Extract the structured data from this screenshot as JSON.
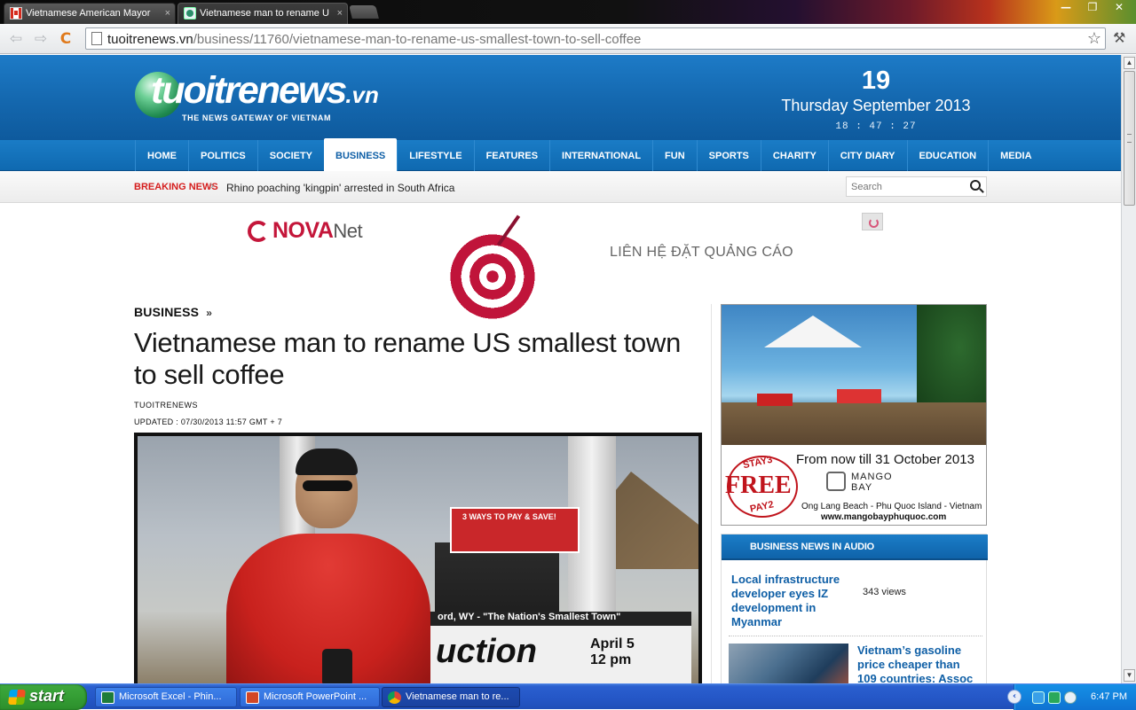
{
  "browser": {
    "tabs": [
      {
        "title": "Vietnamese American Mayor",
        "close": "×"
      },
      {
        "title": "Vietnamese man to rename U",
        "close": "×"
      }
    ],
    "window_buttons": [
      "—",
      "❐",
      "✕"
    ],
    "url_host": "tuoitrenews.vn",
    "url_path": "/business/11760/vietnamese-man-to-rename-us-smallest-town-to-sell-coffee",
    "back_icon": "⇦",
    "forward_icon": "⇨",
    "reload_icon": "C",
    "star_icon": "☆",
    "wrench_icon": "⚒"
  },
  "site": {
    "logo": "tuoitrenews",
    "logo_tld": ".vn",
    "tagline": "THE NEWS GATEWAY OF VIETNAM",
    "day": "19",
    "date": "Thursday September 2013",
    "time": "18 : 47 : 27"
  },
  "nav": {
    "items": [
      "HOME",
      "POLITICS",
      "SOCIETY",
      "BUSINESS",
      "LIFESTYLE",
      "FEATURES",
      "INTERNATIONAL",
      "FUN",
      "SPORTS",
      "CHARITY",
      "CITY DIARY",
      "EDUCATION",
      "MEDIA"
    ],
    "active": "BUSINESS"
  },
  "breaking": {
    "label": "BREAKING NEWS",
    "arrow": "›",
    "headline": "Rhino poaching 'kingpin' arrested in South Africa",
    "search_placeholder": "Search"
  },
  "ad_banner": {
    "brand": "NOVA",
    "brand_suffix": "Net",
    "text": "LIÊN HỆ ĐẶT QUẢNG CÁO"
  },
  "article": {
    "section": "BUSINESS",
    "section_chev": "»",
    "title": "Vietnamese man to rename US smallest town to sell coffee",
    "byline": "TUOITRENEWS",
    "updated": "UPDATED : 07/30/2013 11:57 GMT + 7",
    "photo": {
      "sign": "3 WAYS TO PAY & SAVE!",
      "board_top": "ord, WY - \"The Nation's Smallest Town\"",
      "board_big": "uction",
      "board_date_1": "April 5",
      "board_date_2": "12 pm"
    }
  },
  "right_ad": {
    "free_top": "STAY3",
    "free_big": "FREE",
    "free_bot": "PAY2",
    "offer": "From now till 31 October 2013",
    "brand_1": "MANGO",
    "brand_2": "BAY",
    "address": "Ong Lang Beach - Phu Quoc Island - Vietnam",
    "website": "www.mangobayphuquoc.com"
  },
  "audio": {
    "heading": "BUSINESS NEWS IN AUDIO",
    "items": [
      {
        "title": "Local infrastructure developer eyes IZ development in Myanmar",
        "views": "343 views"
      },
      {
        "title": "Vietnam’s gasoline price cheaper than 109 countries: Assoc"
      }
    ]
  },
  "taskbar": {
    "start": "start",
    "tasks": [
      {
        "label": "Microsoft Excel - Phin..."
      },
      {
        "label": "Microsoft PowerPoint ..."
      },
      {
        "label": "Vietnamese man to re..."
      }
    ],
    "tray_chev": "‹",
    "clock": "6:47 PM"
  },
  "colors": {
    "brand_blue": "#1467ae",
    "breaking_red": "#d51d1d",
    "link_blue": "#0f5fa6",
    "xp_start_green": "#36a036"
  }
}
